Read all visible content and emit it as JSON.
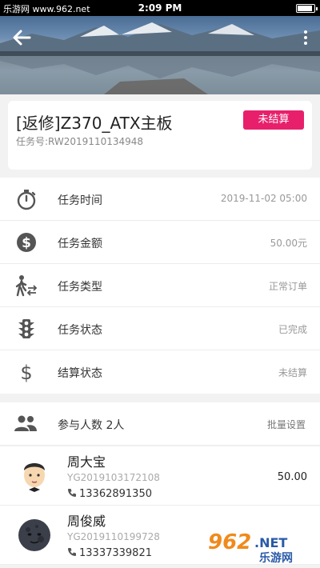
{
  "status_bar": {
    "site": "乐游网 www.962.net",
    "time": "2:09 PM"
  },
  "task": {
    "title": "[返修]Z370_ATX主板",
    "number_label": "任务号:",
    "number": "RW2019110134948",
    "badge": "未结算",
    "badge_color": "#e8206c"
  },
  "info_rows": [
    {
      "icon": "stopwatch-icon",
      "label": "任务时间",
      "value": "2019-11-02 05:00"
    },
    {
      "icon": "dollar-circle-icon",
      "label": "任务金额",
      "value": "50.00元"
    },
    {
      "icon": "walk-transfer-icon",
      "label": "任务类型",
      "value": "正常订单"
    },
    {
      "icon": "traffic-light-icon",
      "label": "任务状态",
      "value": "已完成"
    },
    {
      "icon": "dollar-sign-icon",
      "label": "结算状态",
      "value": "未结算"
    }
  ],
  "participants": {
    "label": "参与人数 2人",
    "action": "批量设置",
    "members": [
      {
        "name": "周大宝",
        "code": "YG2019103172108",
        "phone": "13362891350",
        "amount": "50.00"
      },
      {
        "name": "周俊威",
        "code": "YG2019110199728",
        "phone": "13337339821",
        "amount": ""
      }
    ]
  },
  "watermark": {
    "number": "962",
    "suffix": ".NET",
    "cn": "乐游网"
  }
}
